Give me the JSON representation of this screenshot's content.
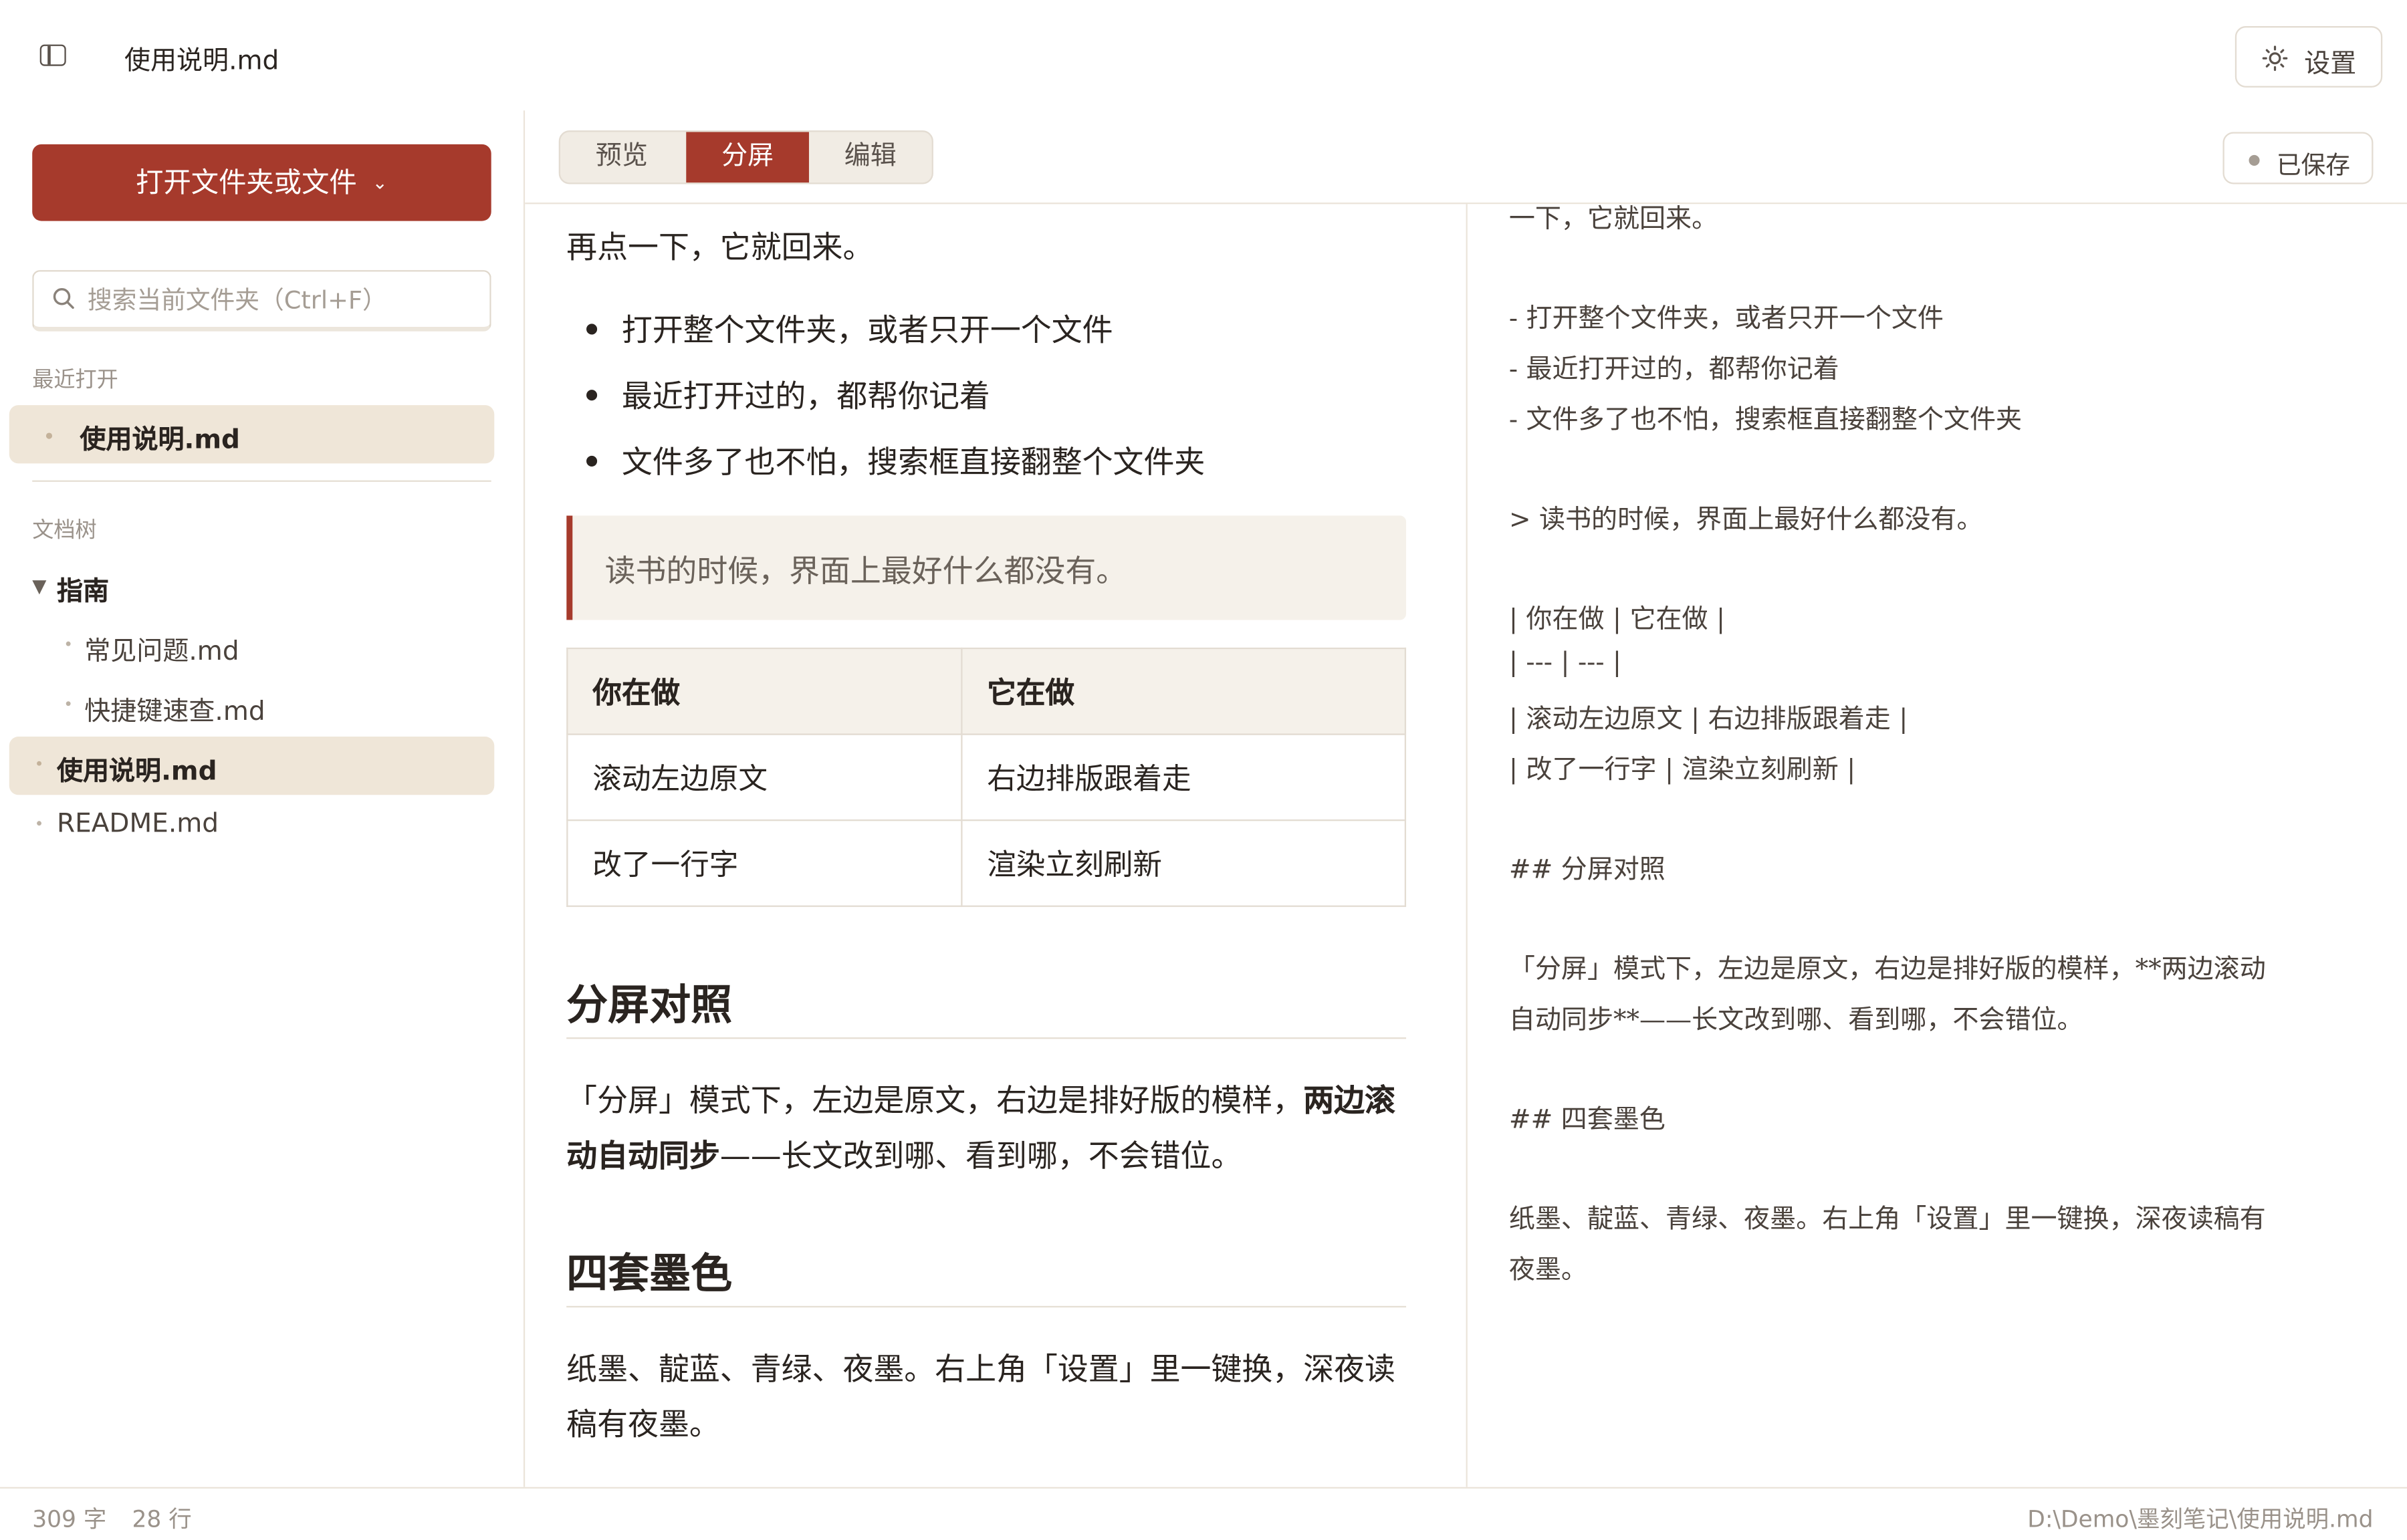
{
  "header": {
    "title": "使用说明.md",
    "settings_label": "设置"
  },
  "sidebar": {
    "open_button": "打开文件夹或文件",
    "search_placeholder": "搜索当前文件夹（Ctrl+F）",
    "recent_label": "最近打开",
    "recent_items": [
      "使用说明.md"
    ],
    "tree_label": "文档树",
    "tree": {
      "folder": "指南",
      "folder_children": [
        "常见问题.md",
        "快捷键速查.md"
      ],
      "active_file": "使用说明.md",
      "other_file": "README.md"
    }
  },
  "viewbar": {
    "modes": [
      "预览",
      "分屏",
      "编辑"
    ],
    "active_mode": "分屏",
    "saved_label": "已保存"
  },
  "preview": {
    "line_top": "再点一下，它就回来。",
    "bullets": [
      "打开整个文件夹，或者只开一个文件",
      "最近打开过的，都帮你记着",
      "文件多了也不怕，搜索框直接翻整个文件夹"
    ],
    "quote": "读书的时候，界面上最好什么都没有。",
    "table": {
      "headers": [
        "你在做",
        "它在做"
      ],
      "rows": [
        [
          "滚动左边原文",
          "右边排版跟着走"
        ],
        [
          "改了一行字",
          "渲染立刻刷新"
        ]
      ]
    },
    "h2_split": "分屏对照",
    "split_para_a": "「分屏」模式下，左边是原文，右边是排好版的模样，",
    "split_para_bold_a": "两边滚",
    "split_para_bold_b": "动自动同步",
    "split_para_b": "——长文改到哪、看到哪，不会错位。",
    "h2_ink": "四套墨色",
    "ink_para_a": "纸墨、靛蓝、青绿、夜墨。右上角「设置」里一键换，深夜读",
    "ink_para_b": "稿有夜墨。"
  },
  "source": {
    "lines": [
      "一下，它就回来。",
      "-  打开整个文件夹，或者只开一个文件",
      "-  最近打开过的，都帮你记着",
      "-  文件多了也不怕，搜索框直接翻整个文件夹",
      ">  读书的时候，界面上最好什么都没有。",
      "|  你在做  |  它在做  |",
      "|  ---  |  ---  |",
      "|  滚动左边原文  |  右边排版跟着走  |",
      "|  改了一行字  |  渲染立刻刷新  |",
      "##  分屏对照",
      "「分屏」模式下，左边是原文，右边是排好版的模样，**两边滚动",
      "自动同步**——长文改到哪、看到哪，不会错位。",
      "##  四套墨色",
      "纸墨、靛蓝、青绿、夜墨。右上角「设置」里一键换，深夜读稿有",
      "夜墨。"
    ]
  },
  "status": {
    "words": "309 字",
    "lines": "28 行",
    "path": "D:\\Demo\\墨刻笔记\\使用说明.md"
  },
  "colors": {
    "accent": "#a63a2c",
    "highlight": "#efe6d8",
    "quote_bg": "#f5f1ea"
  }
}
